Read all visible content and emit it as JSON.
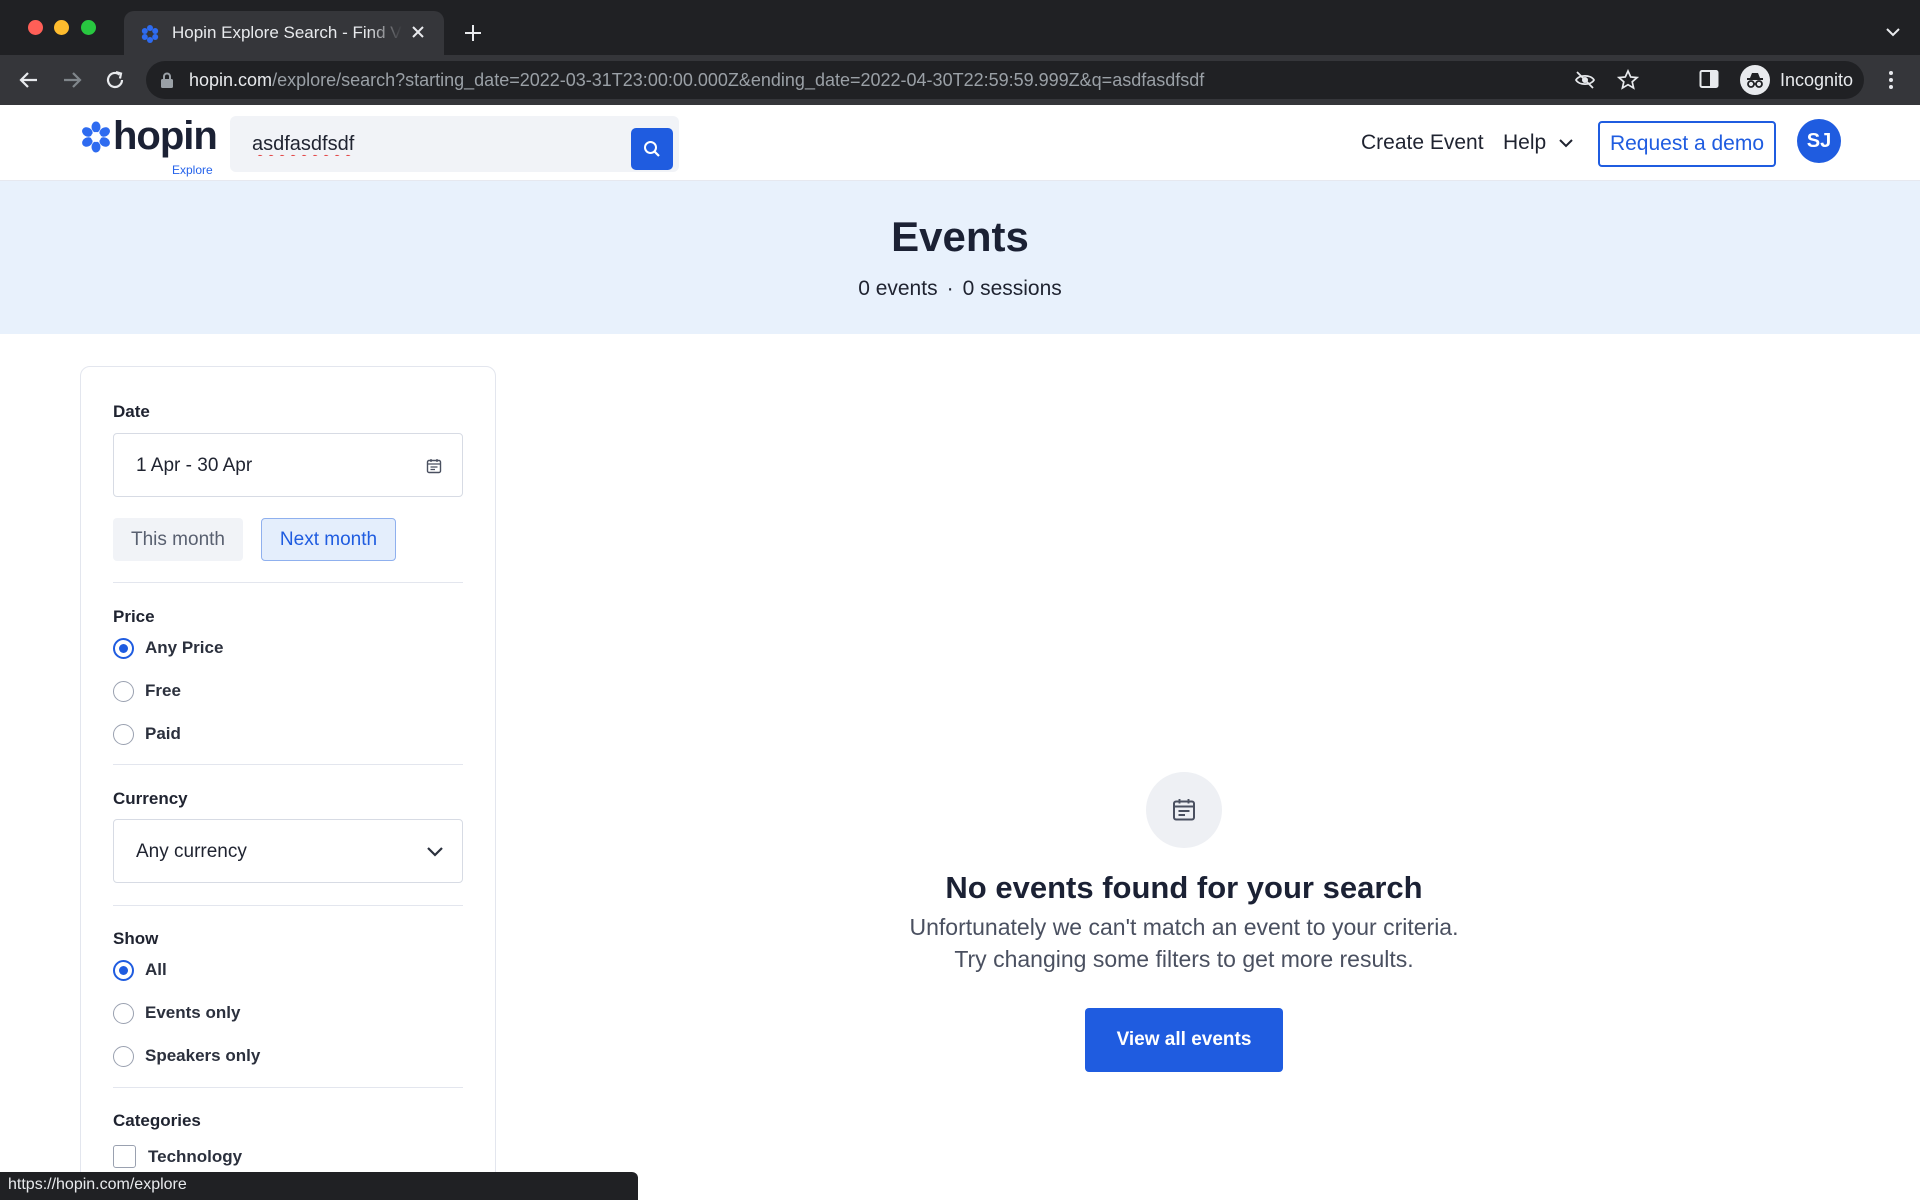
{
  "browser": {
    "tab_title": "Hopin Explore Search - Find Virtual Events",
    "url_host": "hopin.com",
    "url_path": "/explore/search?starting_date=2022-03-31T23:00:00.000Z&ending_date=2022-04-30T22:59:59.999Z&q=asdfasdfsdf",
    "profile_label": "Incognito",
    "status_url": "https://hopin.com/explore"
  },
  "header": {
    "logo_text": "hopin",
    "logo_sub": "Explore",
    "search_value": "asdfasdfsdf",
    "create_event": "Create Event",
    "help": "Help",
    "request_demo": "Request a demo",
    "avatar_initials": "SJ"
  },
  "hero": {
    "title": "Events",
    "events_count": "0 events",
    "separator": "·",
    "sessions_count": "0 sessions"
  },
  "filters": {
    "date": {
      "label": "Date",
      "value": "1 Apr - 30 Apr",
      "this_month": "This month",
      "next_month": "Next month"
    },
    "price": {
      "label": "Price",
      "options": [
        "Any Price",
        "Free",
        "Paid"
      ],
      "selected": "Any Price"
    },
    "currency": {
      "label": "Currency",
      "value": "Any currency"
    },
    "show": {
      "label": "Show",
      "options": [
        "All",
        "Events only",
        "Speakers only"
      ],
      "selected": "All"
    },
    "categories": {
      "label": "Categories",
      "items": [
        "Technology"
      ]
    }
  },
  "empty_state": {
    "icon": "calendar-icon",
    "title": "No events found for your search",
    "line1": "Unfortunately we can't match an event to your criteria.",
    "line2": "Try changing some filters to get more results.",
    "button": "View all events"
  },
  "colors": {
    "brand_blue": "#1f5ce0",
    "hero_bg": "#e8f1fc",
    "chrome_dark": "#202124"
  }
}
